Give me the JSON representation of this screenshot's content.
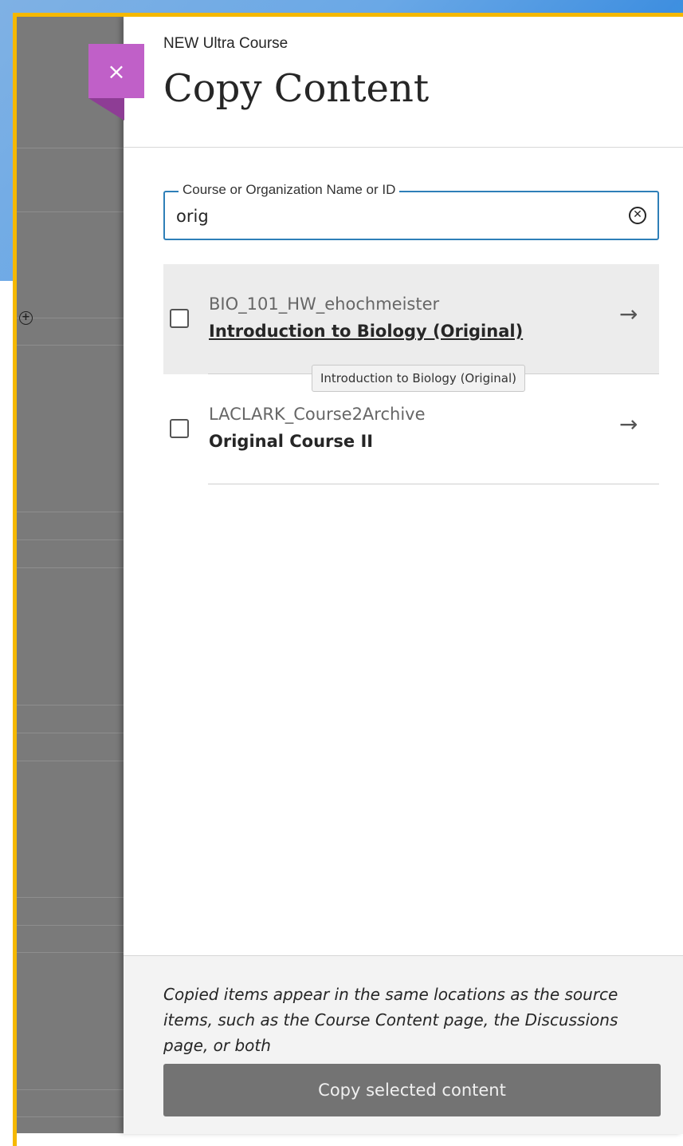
{
  "panel": {
    "subtitle": "NEW Ultra Course",
    "title": "Copy Content",
    "close_label": "×"
  },
  "search": {
    "label": "Course or Organization Name or ID",
    "value": "orig",
    "clear_glyph": "✕"
  },
  "results": [
    {
      "id": "BIO_101_HW_ehochmeister",
      "name": "Introduction to Biology (Original)",
      "checked": false,
      "hovered": true
    },
    {
      "id": "LACLARK_Course2Archive",
      "name": "Original Course II",
      "checked": false,
      "hovered": false
    }
  ],
  "arrow_glyph": "→",
  "tooltip": "Introduction to Biology (Original)",
  "footer": {
    "note": "Copied items appear in the same locations as the source items, such as the Course Content page, the Discussions page, or both",
    "button_label": "Copy selected content"
  },
  "colors": {
    "accent_close": "#c060c8",
    "focus_frame": "#f5b800",
    "search_border": "#2e7fb8",
    "button_bg": "#737373"
  }
}
